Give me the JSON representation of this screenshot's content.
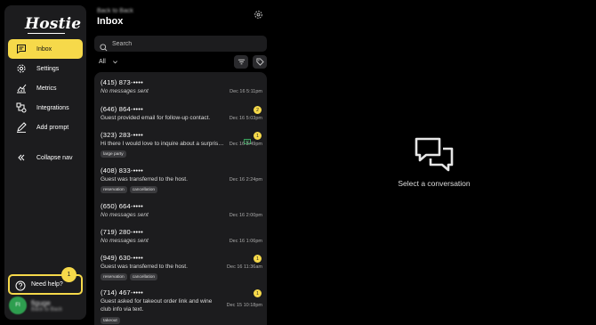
{
  "app": {
    "logo": "Hostie"
  },
  "sidebar": {
    "items": [
      {
        "label": "Inbox",
        "icon": "inbox-icon"
      },
      {
        "label": "Settings",
        "icon": "gear-icon"
      },
      {
        "label": "Metrics",
        "icon": "chart-icon"
      },
      {
        "label": "Integrations",
        "icon": "integrations-icon"
      },
      {
        "label": "Add prompt",
        "icon": "pen-icon"
      },
      {
        "label": "Collapse nav",
        "icon": "double-chevron-left-icon"
      }
    ],
    "help": {
      "label": "Need help?",
      "badge": "1"
    },
    "user": {
      "initials": "FI",
      "name": "figuge",
      "restaurant": "Back to Back"
    }
  },
  "header": {
    "restaurant": "Back to Back",
    "title": "Inbox"
  },
  "search": {
    "placeholder": "Search"
  },
  "filter": {
    "selected": "All"
  },
  "conversations": [
    {
      "phone": "(415) 873-••••",
      "message": "No messages sent",
      "time": "Dec 16 5:11pm",
      "badge": "",
      "tags": []
    },
    {
      "phone": "(646) 864-••••",
      "message": "Guest provided email for follow-up contact.",
      "time": "Dec 16 5:03pm",
      "badge": "2",
      "tags": []
    },
    {
      "phone": "(323) 283-••••",
      "message": "Hi there I would love to inquire about a surprise party",
      "time": "Dec 16 3:49pm",
      "badge": "1",
      "tags": [
        "large party"
      ]
    },
    {
      "phone": "(408) 833-••••",
      "message": "Guest was transferred to the host.",
      "time": "Dec 16 2:24pm",
      "badge": "",
      "tags": [
        "reservation",
        "cancellation"
      ]
    },
    {
      "phone": "(650) 664-••••",
      "message": "No messages sent",
      "time": "Dec 16 2:00pm",
      "badge": "",
      "tags": []
    },
    {
      "phone": "(719) 280-••••",
      "message": "No messages sent",
      "time": "Dec 16 1:06pm",
      "badge": "",
      "tags": []
    },
    {
      "phone": "(949) 630-••••",
      "message": "Guest was transferred to the host.",
      "time": "Dec 16 11:36am",
      "badge": "1",
      "tags": [
        "reservation",
        "cancellation"
      ]
    },
    {
      "phone": "(714) 467-••••",
      "message": "Guest asked for takeout order link and wine club info via text.",
      "time": "Dec 15 10:18pm",
      "badge": "1",
      "tags": [
        "takeout"
      ]
    }
  ],
  "empty_state": {
    "text": "Select a conversation",
    "icon": "chat-bubbles-icon"
  },
  "colors": {
    "accent": "#f6d94a",
    "panel": "#1c1c1e",
    "background": "#000000"
  }
}
